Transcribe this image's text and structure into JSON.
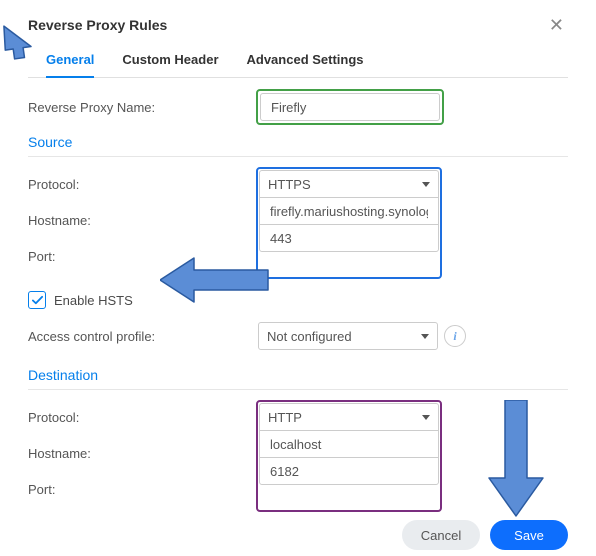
{
  "colors": {
    "accent": "#057feb",
    "arrow_fill": "#5b8dd6",
    "arrow_stroke": "#2a5aa0",
    "btn_primary": "#0d6efd"
  },
  "titlebar": {
    "title": "Reverse Proxy Rules",
    "close_glyph": "✕"
  },
  "tabs": [
    {
      "id": "general",
      "label": "General",
      "active": true
    },
    {
      "id": "custom",
      "label": "Custom Header",
      "active": false
    },
    {
      "id": "advanced",
      "label": "Advanced Settings",
      "active": false
    }
  ],
  "fields": {
    "name_label": "Reverse Proxy Name:",
    "name_value": "Firefly"
  },
  "source": {
    "title": "Source",
    "protocol_label": "Protocol:",
    "protocol_value": "HTTPS",
    "hostname_label": "Hostname:",
    "hostname_value": "firefly.mariushosting.synology",
    "port_label": "Port:",
    "port_value": "443",
    "hsts_label": "Enable HSTS",
    "hsts_checked": true,
    "acp_label": "Access control profile:",
    "acp_value": "Not configured"
  },
  "destination": {
    "title": "Destination",
    "protocol_label": "Protocol:",
    "protocol_value": "HTTP",
    "hostname_label": "Hostname:",
    "hostname_value": "localhost",
    "port_label": "Port:",
    "port_value": "6182"
  },
  "footer": {
    "cancel": "Cancel",
    "save": "Save"
  },
  "info_glyph": "i"
}
